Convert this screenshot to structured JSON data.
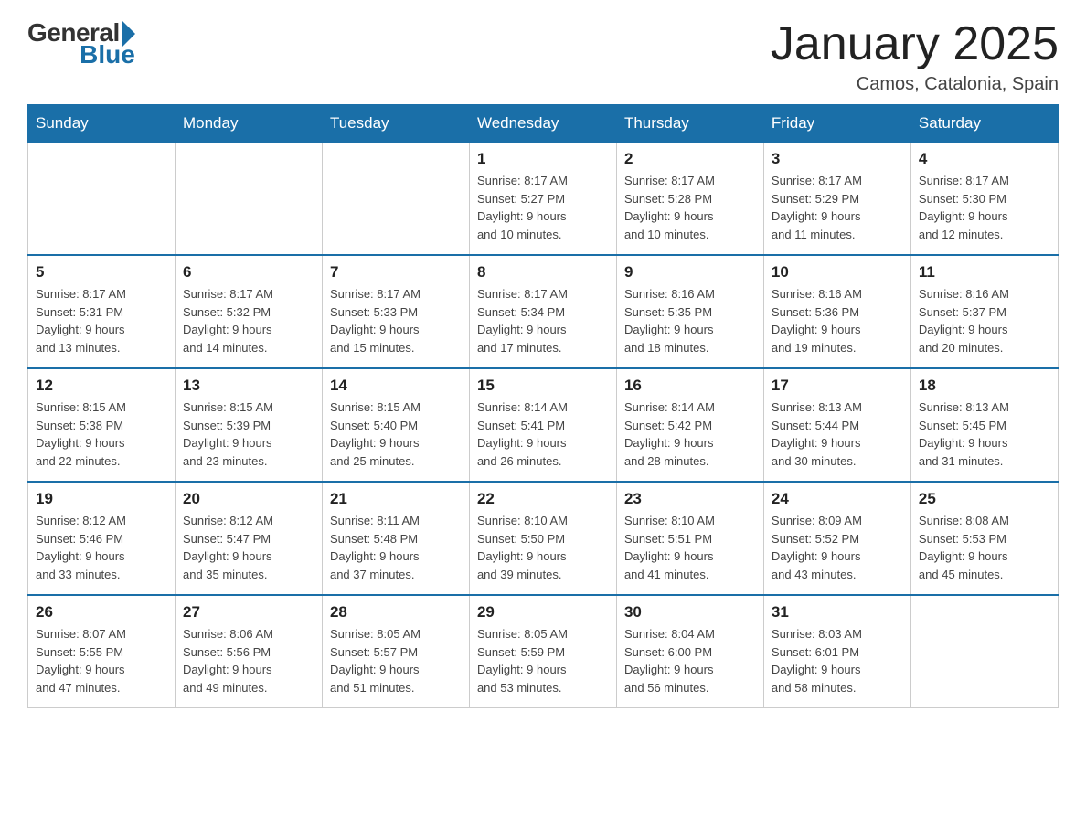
{
  "header": {
    "logo": {
      "general": "General",
      "blue": "Blue"
    },
    "title": "January 2025",
    "location": "Camos, Catalonia, Spain"
  },
  "calendar": {
    "days_of_week": [
      "Sunday",
      "Monday",
      "Tuesday",
      "Wednesday",
      "Thursday",
      "Friday",
      "Saturday"
    ],
    "weeks": [
      [
        {
          "day": "",
          "info": ""
        },
        {
          "day": "",
          "info": ""
        },
        {
          "day": "",
          "info": ""
        },
        {
          "day": "1",
          "info": "Sunrise: 8:17 AM\nSunset: 5:27 PM\nDaylight: 9 hours\nand 10 minutes."
        },
        {
          "day": "2",
          "info": "Sunrise: 8:17 AM\nSunset: 5:28 PM\nDaylight: 9 hours\nand 10 minutes."
        },
        {
          "day": "3",
          "info": "Sunrise: 8:17 AM\nSunset: 5:29 PM\nDaylight: 9 hours\nand 11 minutes."
        },
        {
          "day": "4",
          "info": "Sunrise: 8:17 AM\nSunset: 5:30 PM\nDaylight: 9 hours\nand 12 minutes."
        }
      ],
      [
        {
          "day": "5",
          "info": "Sunrise: 8:17 AM\nSunset: 5:31 PM\nDaylight: 9 hours\nand 13 minutes."
        },
        {
          "day": "6",
          "info": "Sunrise: 8:17 AM\nSunset: 5:32 PM\nDaylight: 9 hours\nand 14 minutes."
        },
        {
          "day": "7",
          "info": "Sunrise: 8:17 AM\nSunset: 5:33 PM\nDaylight: 9 hours\nand 15 minutes."
        },
        {
          "day": "8",
          "info": "Sunrise: 8:17 AM\nSunset: 5:34 PM\nDaylight: 9 hours\nand 17 minutes."
        },
        {
          "day": "9",
          "info": "Sunrise: 8:16 AM\nSunset: 5:35 PM\nDaylight: 9 hours\nand 18 minutes."
        },
        {
          "day": "10",
          "info": "Sunrise: 8:16 AM\nSunset: 5:36 PM\nDaylight: 9 hours\nand 19 minutes."
        },
        {
          "day": "11",
          "info": "Sunrise: 8:16 AM\nSunset: 5:37 PM\nDaylight: 9 hours\nand 20 minutes."
        }
      ],
      [
        {
          "day": "12",
          "info": "Sunrise: 8:15 AM\nSunset: 5:38 PM\nDaylight: 9 hours\nand 22 minutes."
        },
        {
          "day": "13",
          "info": "Sunrise: 8:15 AM\nSunset: 5:39 PM\nDaylight: 9 hours\nand 23 minutes."
        },
        {
          "day": "14",
          "info": "Sunrise: 8:15 AM\nSunset: 5:40 PM\nDaylight: 9 hours\nand 25 minutes."
        },
        {
          "day": "15",
          "info": "Sunrise: 8:14 AM\nSunset: 5:41 PM\nDaylight: 9 hours\nand 26 minutes."
        },
        {
          "day": "16",
          "info": "Sunrise: 8:14 AM\nSunset: 5:42 PM\nDaylight: 9 hours\nand 28 minutes."
        },
        {
          "day": "17",
          "info": "Sunrise: 8:13 AM\nSunset: 5:44 PM\nDaylight: 9 hours\nand 30 minutes."
        },
        {
          "day": "18",
          "info": "Sunrise: 8:13 AM\nSunset: 5:45 PM\nDaylight: 9 hours\nand 31 minutes."
        }
      ],
      [
        {
          "day": "19",
          "info": "Sunrise: 8:12 AM\nSunset: 5:46 PM\nDaylight: 9 hours\nand 33 minutes."
        },
        {
          "day": "20",
          "info": "Sunrise: 8:12 AM\nSunset: 5:47 PM\nDaylight: 9 hours\nand 35 minutes."
        },
        {
          "day": "21",
          "info": "Sunrise: 8:11 AM\nSunset: 5:48 PM\nDaylight: 9 hours\nand 37 minutes."
        },
        {
          "day": "22",
          "info": "Sunrise: 8:10 AM\nSunset: 5:50 PM\nDaylight: 9 hours\nand 39 minutes."
        },
        {
          "day": "23",
          "info": "Sunrise: 8:10 AM\nSunset: 5:51 PM\nDaylight: 9 hours\nand 41 minutes."
        },
        {
          "day": "24",
          "info": "Sunrise: 8:09 AM\nSunset: 5:52 PM\nDaylight: 9 hours\nand 43 minutes."
        },
        {
          "day": "25",
          "info": "Sunrise: 8:08 AM\nSunset: 5:53 PM\nDaylight: 9 hours\nand 45 minutes."
        }
      ],
      [
        {
          "day": "26",
          "info": "Sunrise: 8:07 AM\nSunset: 5:55 PM\nDaylight: 9 hours\nand 47 minutes."
        },
        {
          "day": "27",
          "info": "Sunrise: 8:06 AM\nSunset: 5:56 PM\nDaylight: 9 hours\nand 49 minutes."
        },
        {
          "day": "28",
          "info": "Sunrise: 8:05 AM\nSunset: 5:57 PM\nDaylight: 9 hours\nand 51 minutes."
        },
        {
          "day": "29",
          "info": "Sunrise: 8:05 AM\nSunset: 5:59 PM\nDaylight: 9 hours\nand 53 minutes."
        },
        {
          "day": "30",
          "info": "Sunrise: 8:04 AM\nSunset: 6:00 PM\nDaylight: 9 hours\nand 56 minutes."
        },
        {
          "day": "31",
          "info": "Sunrise: 8:03 AM\nSunset: 6:01 PM\nDaylight: 9 hours\nand 58 minutes."
        },
        {
          "day": "",
          "info": ""
        }
      ]
    ]
  }
}
